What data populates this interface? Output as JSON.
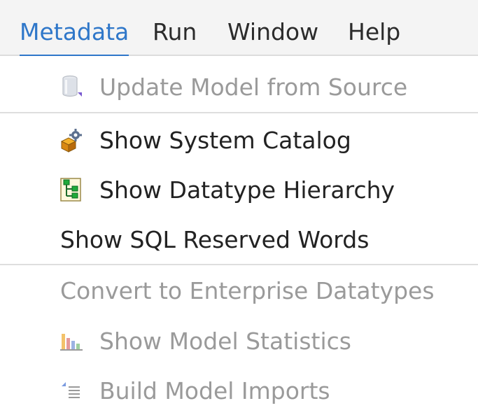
{
  "menubar": {
    "items": [
      {
        "label": "Metadata",
        "active": true
      },
      {
        "label": "Run"
      },
      {
        "label": "Window"
      },
      {
        "label": "Help"
      }
    ]
  },
  "dropdown": {
    "items": [
      {
        "label": "Update Model from Source",
        "icon": "database-cylinder-icon",
        "enabled": false
      },
      {
        "label": "Show System Catalog",
        "icon": "system-catalog-cubes-icon",
        "enabled": true
      },
      {
        "label": "Show Datatype Hierarchy",
        "icon": "datatype-hierarchy-tree-icon",
        "enabled": true
      },
      {
        "label": "Show SQL Reserved Words",
        "icon": null,
        "enabled": true
      },
      {
        "label": "Convert to Enterprise Datatypes",
        "icon": null,
        "enabled": false
      },
      {
        "label": "Show Model Statistics",
        "icon": "bar-chart-icon",
        "enabled": false
      },
      {
        "label": "Build Model Imports",
        "icon": "build-imports-list-icon",
        "enabled": false
      }
    ]
  },
  "colors": {
    "accent": "#2f77c9",
    "text": "#222222",
    "disabled_text": "#9a9a9a",
    "menubar_bg": "#f4f4f4",
    "separator": "#dedede"
  }
}
